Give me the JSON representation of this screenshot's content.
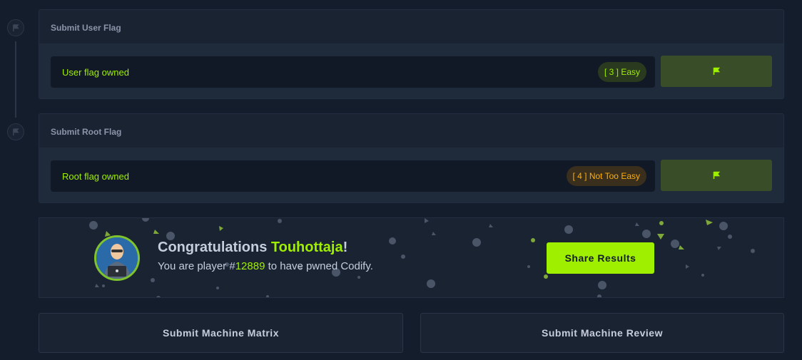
{
  "timeline": {
    "icon": "flag-icon"
  },
  "user_flag": {
    "section_title": "Submit User Flag",
    "status": "User flag owned",
    "difficulty": "[ 3 ] Easy",
    "button_icon": "flag-icon"
  },
  "root_flag": {
    "section_title": "Submit Root Flag",
    "status": "Root flag owned",
    "difficulty": "[ 4 ] Not Too Easy",
    "button_icon": "flag-icon"
  },
  "congrats": {
    "prefix": "Congratulations ",
    "username": "Touhottaja",
    "suffix": "!",
    "player_text_before": "You are player #",
    "player_number": "12889",
    "player_text_after": " to have pwned Codify.",
    "share_label": "Share Results"
  },
  "actions": {
    "matrix_label": "Submit Machine Matrix",
    "review_label": "Submit Machine Review"
  },
  "colors": {
    "accent": "#9fef00",
    "background": "#141d2b",
    "panel": "#1a2332",
    "easy": "#9fef00",
    "medium": "#ffaf00"
  }
}
